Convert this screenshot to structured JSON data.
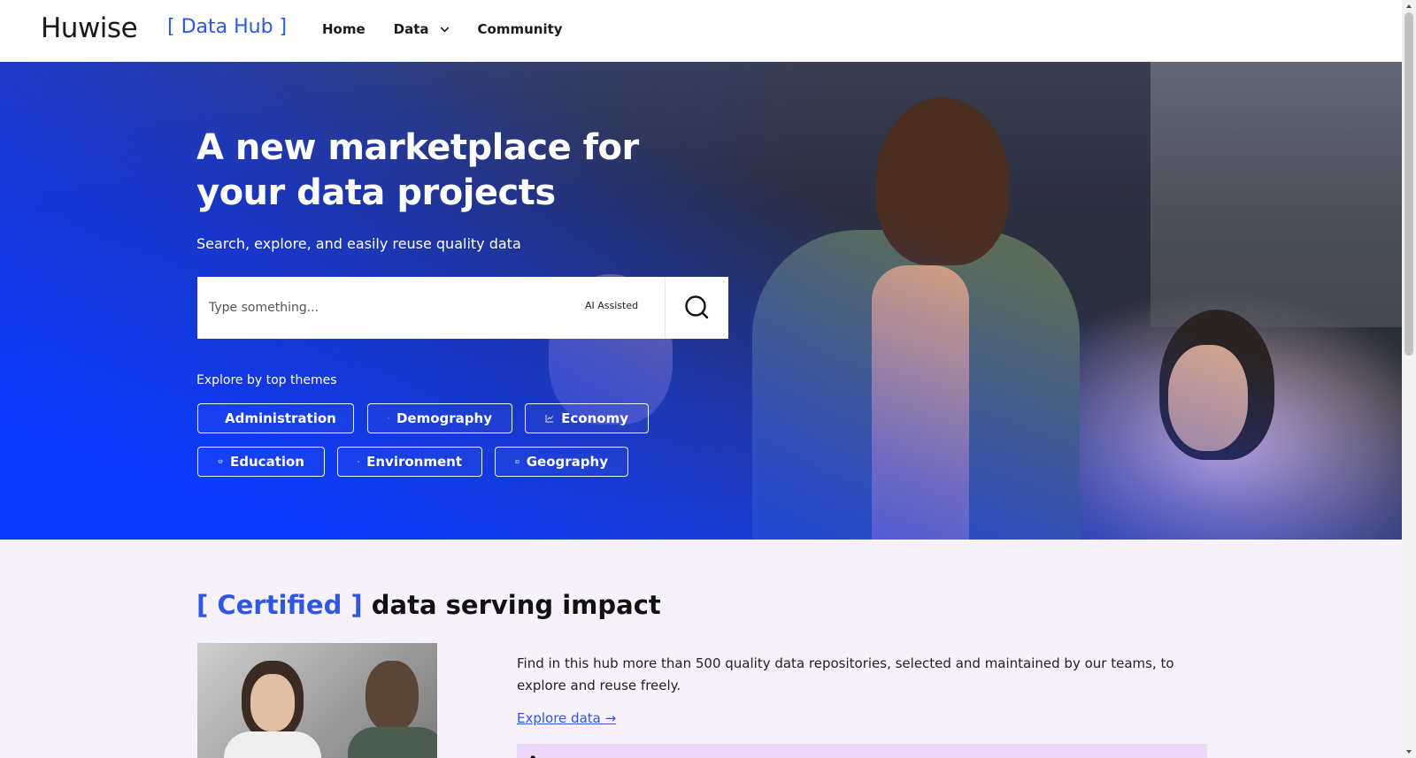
{
  "header": {
    "logo_text": "Huwise",
    "hub_name": "[ Data Hub ]",
    "nav": [
      {
        "label": "Home"
      },
      {
        "label": "Data"
      },
      {
        "label": "Community"
      }
    ]
  },
  "hero": {
    "title": "A new marketplace for your data projects",
    "subtitle": "Search, explore, and easily reuse quality data",
    "search": {
      "placeholder": "Type something...",
      "ai_label": "AI Assisted"
    },
    "themes_label": "Explore by top themes",
    "themes": [
      {
        "label": "Administration",
        "icon": "administration-icon"
      },
      {
        "label": "Demography",
        "icon": "people-icon"
      },
      {
        "label": "Economy",
        "icon": "chart-line-icon"
      },
      {
        "label": "Education",
        "icon": "graduation-cap-icon"
      },
      {
        "label": "Environment",
        "icon": "atom-icon"
      },
      {
        "label": "Geography",
        "icon": "map-icon"
      }
    ]
  },
  "certified": {
    "title_accent": "[ Certified ]",
    "title_rest": " data serving impact",
    "description": "Find in this hub more than 500 quality data repositories, selected and maintained by our teams, to explore and reuse freely.",
    "link": "Explore data →",
    "banner_text": "A"
  },
  "colors": {
    "accent": "#2f57e6",
    "hero_blue": "#0a3cff",
    "section_bg": "#f6f1fb",
    "banner_bg": "#ecd9f7"
  }
}
